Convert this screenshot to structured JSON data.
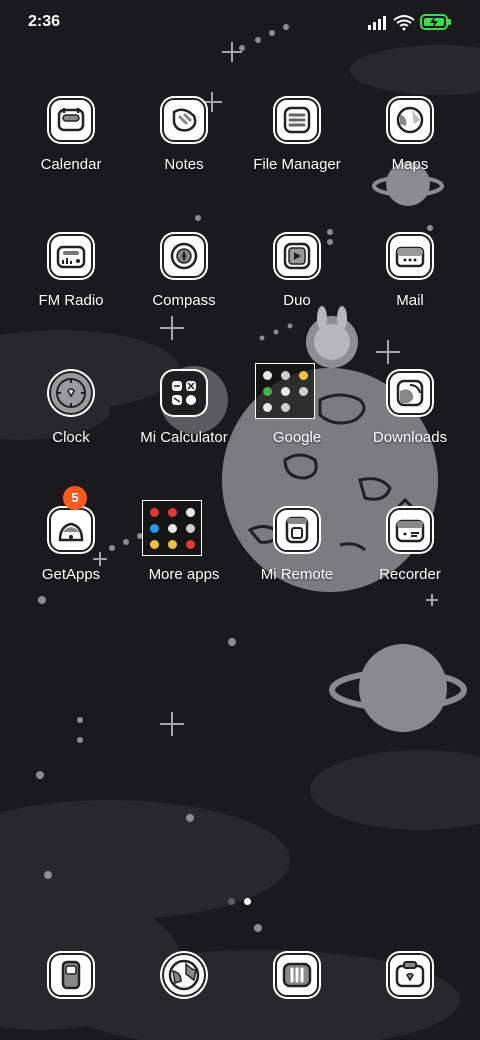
{
  "status_bar": {
    "time": "2:36",
    "icons": [
      "signal-icon",
      "wifi-icon",
      "battery-charging-icon"
    ],
    "battery_color": "#3ddc4a"
  },
  "apps": [
    {
      "label": "Calendar",
      "icon": "calendar-icon"
    },
    {
      "label": "Notes",
      "icon": "notes-icon"
    },
    {
      "label": "File Manager",
      "icon": "file-manager-icon"
    },
    {
      "label": "Maps",
      "icon": "maps-icon"
    },
    {
      "label": "FM Radio",
      "icon": "radio-icon"
    },
    {
      "label": "Compass",
      "icon": "compass-icon"
    },
    {
      "label": "Duo",
      "icon": "video-call-icon"
    },
    {
      "label": "Mail",
      "icon": "mail-icon"
    },
    {
      "label": "Clock",
      "icon": "clock-icon"
    },
    {
      "label": "Mi Calculator",
      "icon": "calculator-icon"
    },
    {
      "label": "Google",
      "icon": "folder-icon"
    },
    {
      "label": "Downloads",
      "icon": "downloads-icon"
    },
    {
      "label": "GetApps",
      "icon": "store-bag-icon",
      "badge": "5"
    },
    {
      "label": "More apps",
      "icon": "folder-icon"
    },
    {
      "label": "Mi Remote",
      "icon": "remote-icon"
    },
    {
      "label": "Recorder",
      "icon": "recorder-icon"
    }
  ],
  "dock": [
    {
      "icon": "phone-icon"
    },
    {
      "icon": "browser-globe-icon"
    },
    {
      "icon": "messages-icon"
    },
    {
      "icon": "camera-icon"
    }
  ],
  "page_indicator": {
    "pages": 2,
    "active": 2
  },
  "colors": {
    "background": "#1a191b",
    "badge": "#ff5a1f",
    "label": "#ffffff"
  }
}
